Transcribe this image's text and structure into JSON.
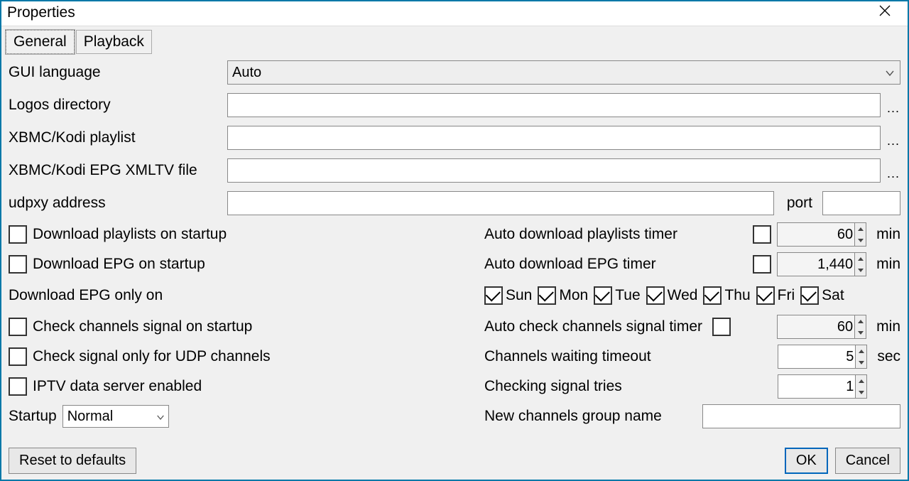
{
  "window": {
    "title": "Properties"
  },
  "tabs": {
    "general": "General",
    "playback": "Playback"
  },
  "labels": {
    "gui_language": "GUI language",
    "logos_directory": "Logos directory",
    "kodi_playlist": "XBMC/Kodi playlist",
    "kodi_epg": "XBMC/Kodi EPG XMLTV file",
    "udpxy_address": "udpxy address",
    "port": "port",
    "download_playlists_startup": "Download playlists on startup",
    "download_epg_startup": "Download EPG on startup",
    "auto_dl_playlists_timer": "Auto download playlists timer",
    "auto_dl_epg_timer": "Auto download EPG timer",
    "download_epg_only_on": "Download EPG only on",
    "check_channels_signal": "Check channels signal on startup",
    "check_signal_udp": "Check signal only for UDP channels",
    "iptv_data_server": "IPTV data server enabled",
    "auto_check_channels_signal_timer": "Auto check channels signal timer",
    "channels_waiting_timeout": "Channels waiting timeout",
    "checking_signal_tries": "Checking signal tries",
    "new_channels_group": "New channels group name",
    "startup": "Startup",
    "min": "min",
    "sec": "sec"
  },
  "values": {
    "gui_language": "Auto",
    "logos_directory": "",
    "kodi_playlist": "",
    "kodi_epg": "",
    "udpxy_address": "",
    "port": "",
    "playlists_timer": "60",
    "epg_timer": "1,440",
    "signal_timer": "60",
    "waiting_timeout": "5",
    "signal_tries": "1",
    "new_channels_group": "",
    "startup": "Normal"
  },
  "days": {
    "sun": "Sun",
    "mon": "Mon",
    "tue": "Tue",
    "wed": "Wed",
    "thu": "Thu",
    "fri": "Fri",
    "sat": "Sat"
  },
  "buttons": {
    "reset": "Reset to defaults",
    "ok": "OK",
    "cancel": "Cancel",
    "browse": "..."
  }
}
